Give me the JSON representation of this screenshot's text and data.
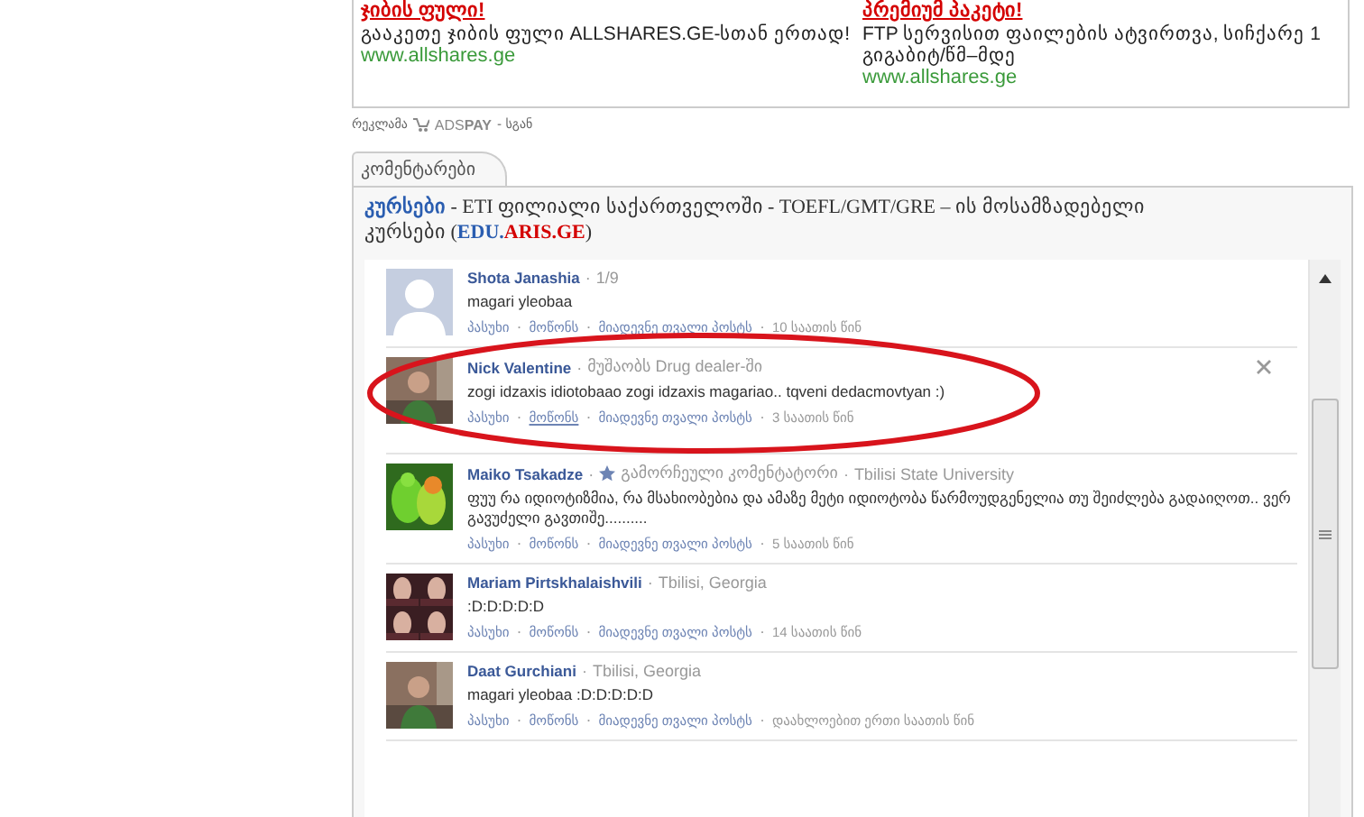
{
  "ads": [
    {
      "title": "ჯიბის ფული!",
      "text": "გააკეთე ჯიბის ფული ALLSHARES.GE-სთან ერთად!",
      "url": "www.allshares.ge"
    },
    {
      "title": "პრემიუმ პაკეტი!",
      "text": "FTP სერვისით ფაილების ატვირთვა, სიჩქარე 1 გიგაბიტ/წმ–მდე",
      "url": "www.allshares.ge"
    }
  ],
  "ad_credit": {
    "prefix": "რეკლამა",
    "brand_ads": "ADS",
    "brand_pay": "PAY",
    "suffix": "- სგან"
  },
  "comments_tab": {
    "label": "კომენტარები"
  },
  "promo": [
    {
      "text": "კურსები",
      "kind": "link"
    },
    {
      "text": " - ETI ფილიალი საქართველოში - TOEFL/GMT/GRE – ის მოსამზადებელი კურსები (",
      "kind": "plain"
    },
    {
      "text": "EDU.",
      "kind": "brand"
    },
    {
      "text": "ARIS.GE",
      "kind": "accent"
    },
    {
      "text": ")",
      "kind": "plain"
    }
  ],
  "comments": [
    {
      "author": "Shota Janashia",
      "name_sep": "·",
      "featured": false,
      "meta": "1/9",
      "text": "magari yleobaa",
      "actions": [
        {
          "label": "პასუხი",
          "hovered": false
        },
        {
          "sep": "·",
          "label": "მოწონს",
          "hovered": false
        },
        {
          "sep": "·",
          "label": "მიადევნე თვალი პოსტს",
          "hovered": false
        }
      ],
      "time_sep": "·",
      "time": "10 საათის წინ",
      "avatar": {
        "kind": "silhouette"
      },
      "closable": false,
      "circled": false
    },
    {
      "author": "Nick Valentine",
      "name_sep": "·",
      "featured": false,
      "meta": "მუშაობს Drug dealer-ში",
      "text": "zogi idzaxis idiotobaao zogi idzaxis magariao.. tqveni dedacmovtyan :)",
      "actions": [
        {
          "label": "პასუხი",
          "hovered": false
        },
        {
          "sep": "·",
          "label": "მოწონს",
          "hovered": true
        },
        {
          "sep": "·",
          "label": "მიადევნე თვალი პოსტს",
          "hovered": false
        }
      ],
      "time_sep": "·",
      "time": "3 საათის წინ",
      "avatar": {
        "kind": "person"
      },
      "closable": true,
      "circled": true
    },
    {
      "author": "Maiko Tsakadze",
      "name_sep": "·",
      "featured": true,
      "badge": "გამორჩეული კომენტატორი",
      "badge_sep": "·",
      "meta": "Tbilisi State University",
      "text": "ფუუ რა იდიოტიზმია, რა მსახიობებია და ამაზე მეტი იდიოტობა წარმოუდგენელია თუ შეიძლება გადაიღოთ.. ვერ გავუძელი გავთიშე..........",
      "actions": [
        {
          "label": "პასუხი",
          "hovered": false
        },
        {
          "sep": "·",
          "label": "მოწონს",
          "hovered": false
        },
        {
          "sep": "·",
          "label": "მიადევნე თვალი პოსტს",
          "hovered": false
        }
      ],
      "time_sep": "·",
      "time": "5 საათის წინ",
      "avatar": {
        "kind": "birds"
      },
      "closable": false,
      "circled": false
    },
    {
      "author": "Mariam Pirtskhalaishvili",
      "name_sep": "·",
      "featured": false,
      "meta": "Tbilisi, Georgia",
      "text": ":D:D:D:D:D",
      "actions": [
        {
          "label": "პასუხი",
          "hovered": false
        },
        {
          "sep": "·",
          "label": "მოწონს",
          "hovered": false
        },
        {
          "sep": "·",
          "label": "მიადევნე თვალი პოსტს",
          "hovered": false
        }
      ],
      "time_sep": "·",
      "time": "14 საათის წინ",
      "avatar": {
        "kind": "grid"
      },
      "closable": false,
      "circled": false
    },
    {
      "author": "Daat Gurchiani",
      "name_sep": "·",
      "featured": false,
      "meta": "Tbilisi, Georgia",
      "text": "magari yleobaa :D:D:D:D:D",
      "actions": [
        {
          "label": "პასუხი",
          "hovered": false
        },
        {
          "sep": "·",
          "label": "მოწონს",
          "hovered": false
        },
        {
          "sep": "·",
          "label": "მიადევნე თვალი პოსტს",
          "hovered": false
        }
      ],
      "time_sep": "·",
      "time": "დაახლოებით ერთი საათის წინ",
      "avatar": {
        "kind": "person"
      },
      "closable": false,
      "circled": false
    }
  ]
}
